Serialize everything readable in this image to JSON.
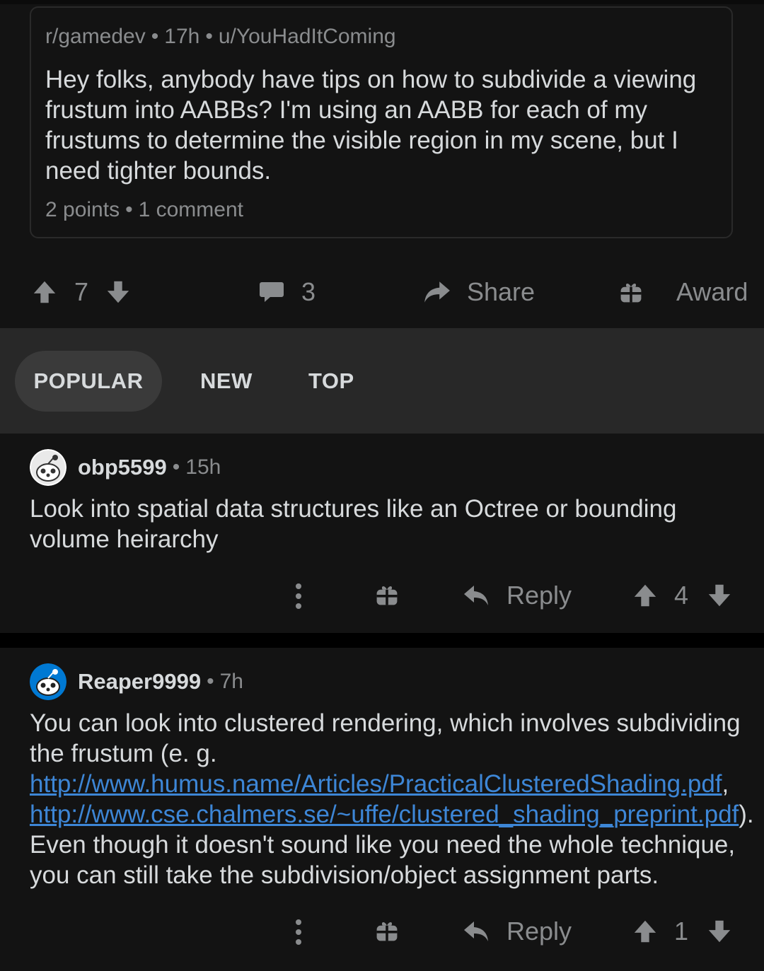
{
  "post": {
    "crosspost": {
      "subreddit": "r/gamedev",
      "age": "17h",
      "author": "u/YouHadItComing",
      "separator": "•",
      "body": "Hey folks, anybody have tips on how to subdivide a viewing frustum into AABBs? I'm using an AABB for each of my frustums to determine the visible region in my scene, but I need tighter bounds.",
      "points": "2 points",
      "comments": "1 comment"
    },
    "actions": {
      "score": "7",
      "comment_count": "3",
      "share_label": "Share",
      "award_label": "Award"
    }
  },
  "sort_tabs": {
    "items": [
      {
        "label": "POPULAR",
        "active": true
      },
      {
        "label": "NEW",
        "active": false
      },
      {
        "label": "TOP",
        "active": false
      }
    ]
  },
  "comments": [
    {
      "author": "obp5599",
      "age": "15h",
      "separator": "•",
      "avatar_color": "#ffffff",
      "body": "Look into spatial data structures like an Octree or bounding volume heirarchy",
      "reply_label": "Reply",
      "score": "4"
    },
    {
      "author": "Reaper9999",
      "age": "7h",
      "separator": "•",
      "avatar_color": "#0079d3",
      "body_parts": {
        "text1": "You can look into clustered rendering, which involves subdividing the frustum (e. g. ",
        "link1": "http://www.humus.name/Articles/PracticalClusteredShading.pdf",
        "text2": ", ",
        "link2": "http://www.cse.chalmers.se/~uffe/clustered_shading_preprint.pdf",
        "text3": "). Even though it doesn't sound like you need the whole technique, you can still take the subdivision/object assignment parts."
      },
      "reply_label": "Reply",
      "score": "1"
    }
  ],
  "colors": {
    "background": "#131313",
    "sort_bar": "#282828",
    "link": "#3d86d6",
    "muted": "#8a8c8e",
    "text": "#d7dadc"
  },
  "icons": [
    "upvote-icon",
    "downvote-icon",
    "comment-icon",
    "share-icon",
    "award-icon",
    "reply-icon",
    "more-options-icon",
    "avatar-icon"
  ]
}
